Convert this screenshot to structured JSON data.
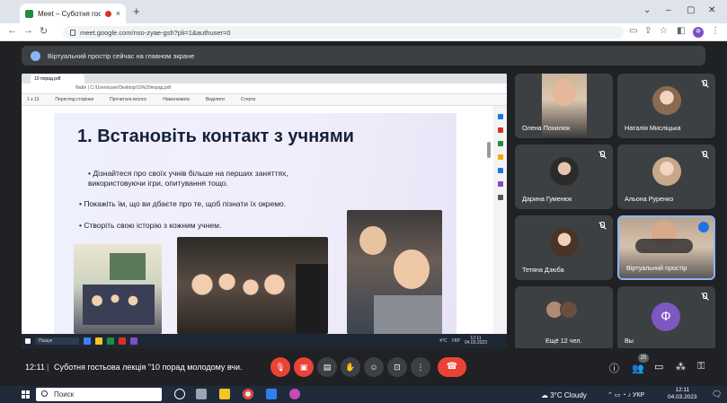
{
  "browser": {
    "tab_title": "Meet – Суботня гостьова лі",
    "tab_close": "×",
    "new_tab": "+",
    "window_controls": [
      "⌄",
      "–",
      "▢",
      "✕"
    ],
    "url": "meet.google.com/nso-zyae-gsh?pli=1&authuser=0",
    "profile_letter": "Ф"
  },
  "presenting_banner": "Віртуальний простір сейчас на главном экране",
  "shared_screen": {
    "tab_label": "10 порад.pdf",
    "address": "Файл | C:/Users/user/Desktop/10%20порад.pdf",
    "page_indicator": "1  з 13",
    "toolbar": [
      "Перегляд сторінки",
      "Прочитати вголос",
      "Намалювати",
      "Виділити",
      "Стерти"
    ],
    "slide": {
      "title": "1. Встановіть контакт з учнями",
      "bullets": [
        "Дізнайтеся про своїх учнів більше на перших заняттях, використовуючи ігри, опитування тощо.",
        "Покажіть їм, що ви дбаєте про те, щоб пізнати їх окремо.",
        "Створіть свою історію з кожним учнем."
      ]
    },
    "taskbar_search": "Пошук",
    "taskbar_weather": "4°C",
    "taskbar_lang": "УКР",
    "taskbar_time": "12:11",
    "taskbar_date": "04.03.2023"
  },
  "participants": [
    {
      "name": "Олена Похилюк",
      "muted": false,
      "video": true
    },
    {
      "name": "Наталія Мисліцька",
      "muted": true,
      "video": false
    },
    {
      "name": "Дарина Гуменюк",
      "muted": true,
      "video": false
    },
    {
      "name": "Альона Руренко",
      "muted": true,
      "video": false
    },
    {
      "name": "Тетяна Дзюба",
      "muted": true,
      "video": false
    },
    {
      "name": "Віртуальний простір",
      "muted": false,
      "video": true
    },
    {
      "name": "Ещё 12 чел.",
      "muted": false,
      "video": false
    },
    {
      "name": "Вы",
      "muted": true,
      "video": false,
      "initial": "Ф"
    }
  ],
  "meeting": {
    "time": "12:11",
    "separator": "|",
    "title": "Суботня гостьова лекція \"10 порад молодому вчи...",
    "participant_count": "20"
  },
  "colors": {
    "meet_bg": "#202124",
    "tile_bg": "#3c4043",
    "red": "#ea4335",
    "active_speaker": "#8ab4f8",
    "you_avatar": "#7e57c2"
  },
  "windows_taskbar": {
    "search_placeholder": "Поиск",
    "weather": "3°C  Cloudy",
    "lang": "УКР",
    "time": "12:11",
    "date": "04.03.2023"
  }
}
